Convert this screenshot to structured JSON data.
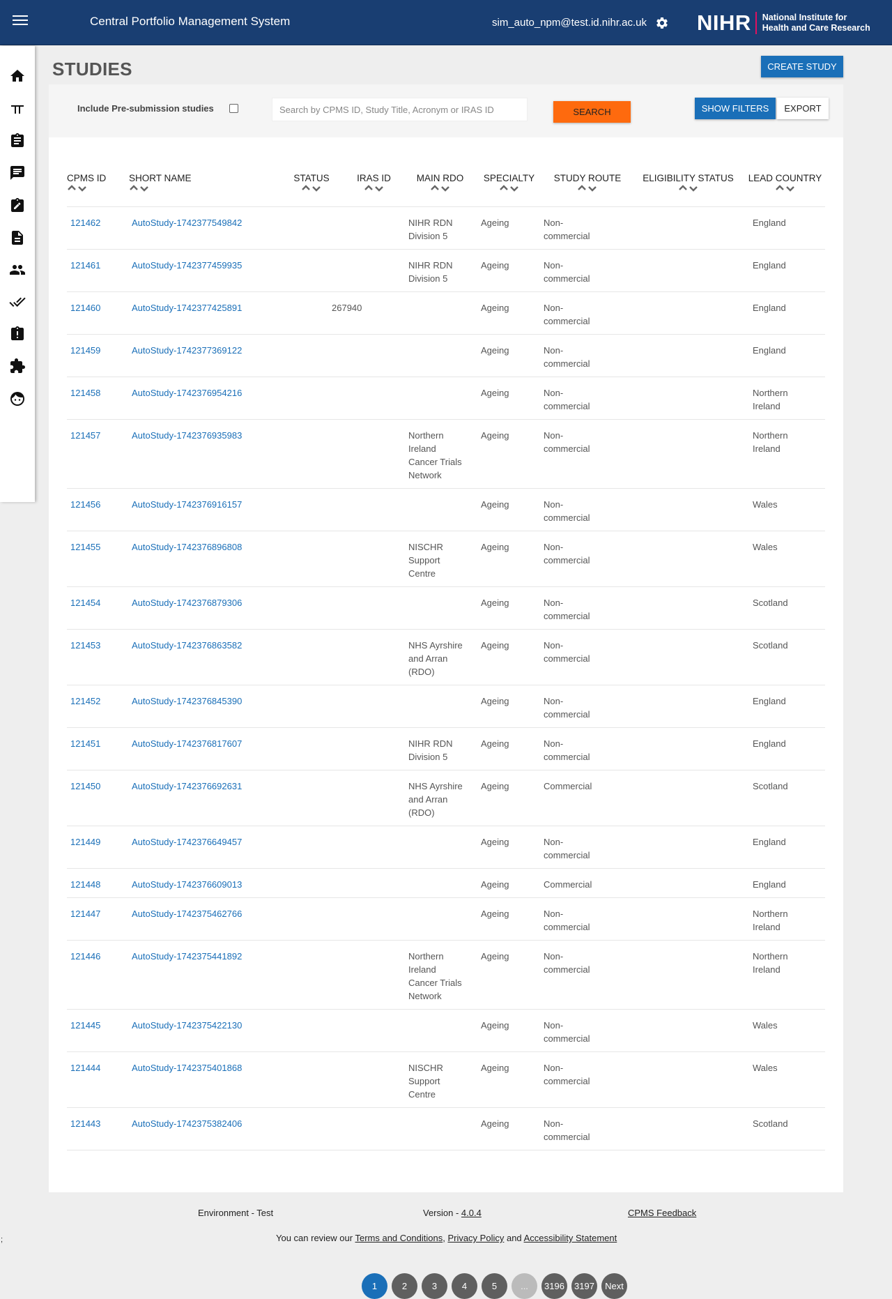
{
  "header": {
    "app_title": "Central Portfolio Management System",
    "user_email": "sim_auto_npm@test.id.nihr.ac.uk",
    "logo_word": "NIHR",
    "logo_sub_1": "National Institute for",
    "logo_sub_2": "Health and Care Research"
  },
  "sidebar": {
    "items": [
      {
        "icon": "home-icon"
      },
      {
        "icon": "table-icon"
      },
      {
        "icon": "clipboard-icon"
      },
      {
        "icon": "feedback-icon"
      },
      {
        "icon": "edit-clipboard-icon"
      },
      {
        "icon": "document-icon"
      },
      {
        "icon": "people-icon"
      },
      {
        "icon": "double-check-icon"
      },
      {
        "icon": "alert-clipboard-icon"
      },
      {
        "icon": "extension-icon"
      },
      {
        "icon": "face-icon"
      }
    ]
  },
  "page": {
    "title": "STUDIES",
    "create_button": "CREATE STUDY"
  },
  "filters": {
    "include_presubmission_label": "Include Pre-submission studies",
    "search_placeholder": "Search by CPMS ID, Study Title, Acronym or IRAS ID",
    "search_button": "SEARCH",
    "show_filters_button": "SHOW FILTERS",
    "export_button": "EXPORT"
  },
  "table": {
    "columns": [
      "CPMS ID",
      "SHORT NAME",
      "STATUS",
      "IRAS ID",
      "MAIN RDO",
      "SPECIALTY",
      "STUDY ROUTE",
      "ELIGIBILITY STATUS",
      "LEAD COUNTRY"
    ],
    "rows": [
      {
        "cpms_id": "121462",
        "short_name": "AutoStudy-1742377549842",
        "status": "",
        "iras_id": "",
        "main_rdo": "NIHR RDN Division 5",
        "specialty": "Ageing",
        "study_route": "Non-commercial",
        "eligibility": "",
        "lead_country": "England"
      },
      {
        "cpms_id": "121461",
        "short_name": "AutoStudy-1742377459935",
        "status": "",
        "iras_id": "",
        "main_rdo": "NIHR RDN Division 5",
        "specialty": "Ageing",
        "study_route": "Non-commercial",
        "eligibility": "",
        "lead_country": "England"
      },
      {
        "cpms_id": "121460",
        "short_name": "AutoStudy-1742377425891",
        "status": "",
        "iras_id": "267940",
        "main_rdo": "",
        "specialty": "Ageing",
        "study_route": "Non-commercial",
        "eligibility": "",
        "lead_country": "England"
      },
      {
        "cpms_id": "121459",
        "short_name": "AutoStudy-1742377369122",
        "status": "",
        "iras_id": "",
        "main_rdo": "",
        "specialty": "Ageing",
        "study_route": "Non-commercial",
        "eligibility": "",
        "lead_country": "England"
      },
      {
        "cpms_id": "121458",
        "short_name": "AutoStudy-1742376954216",
        "status": "",
        "iras_id": "",
        "main_rdo": "",
        "specialty": "Ageing",
        "study_route": "Non-commercial",
        "eligibility": "",
        "lead_country": "Northern Ireland"
      },
      {
        "cpms_id": "121457",
        "short_name": "AutoStudy-1742376935983",
        "status": "",
        "iras_id": "",
        "main_rdo": "Northern Ireland Cancer Trials Network",
        "specialty": "Ageing",
        "study_route": "Non-commercial",
        "eligibility": "",
        "lead_country": "Northern Ireland"
      },
      {
        "cpms_id": "121456",
        "short_name": "AutoStudy-1742376916157",
        "status": "",
        "iras_id": "",
        "main_rdo": "",
        "specialty": "Ageing",
        "study_route": "Non-commercial",
        "eligibility": "",
        "lead_country": "Wales"
      },
      {
        "cpms_id": "121455",
        "short_name": "AutoStudy-1742376896808",
        "status": "",
        "iras_id": "",
        "main_rdo": "NISCHR Support Centre",
        "specialty": "Ageing",
        "study_route": "Non-commercial",
        "eligibility": "",
        "lead_country": "Wales"
      },
      {
        "cpms_id": "121454",
        "short_name": "AutoStudy-1742376879306",
        "status": "",
        "iras_id": "",
        "main_rdo": "",
        "specialty": "Ageing",
        "study_route": "Non-commercial",
        "eligibility": "",
        "lead_country": "Scotland"
      },
      {
        "cpms_id": "121453",
        "short_name": "AutoStudy-1742376863582",
        "status": "",
        "iras_id": "",
        "main_rdo": "NHS Ayrshire and Arran (RDO)",
        "specialty": "Ageing",
        "study_route": "Non-commercial",
        "eligibility": "",
        "lead_country": "Scotland"
      },
      {
        "cpms_id": "121452",
        "short_name": "AutoStudy-1742376845390",
        "status": "",
        "iras_id": "",
        "main_rdo": "",
        "specialty": "Ageing",
        "study_route": "Non-commercial",
        "eligibility": "",
        "lead_country": "England"
      },
      {
        "cpms_id": "121451",
        "short_name": "AutoStudy-1742376817607",
        "status": "",
        "iras_id": "",
        "main_rdo": "NIHR RDN Division 5",
        "specialty": "Ageing",
        "study_route": "Non-commercial",
        "eligibility": "",
        "lead_country": "England"
      },
      {
        "cpms_id": "121450",
        "short_name": "AutoStudy-1742376692631",
        "status": "",
        "iras_id": "",
        "main_rdo": "NHS Ayrshire and Arran (RDO)",
        "specialty": "Ageing",
        "study_route": "Commercial",
        "eligibility": "",
        "lead_country": "Scotland"
      },
      {
        "cpms_id": "121449",
        "short_name": "AutoStudy-1742376649457",
        "status": "",
        "iras_id": "",
        "main_rdo": "",
        "specialty": "Ageing",
        "study_route": "Non-commercial",
        "eligibility": "",
        "lead_country": "England"
      },
      {
        "cpms_id": "121448",
        "short_name": "AutoStudy-1742376609013",
        "status": "",
        "iras_id": "",
        "main_rdo": "",
        "specialty": "Ageing",
        "study_route": "Commercial",
        "eligibility": "",
        "lead_country": "England"
      },
      {
        "cpms_id": "121447",
        "short_name": "AutoStudy-1742375462766",
        "status": "",
        "iras_id": "",
        "main_rdo": "",
        "specialty": "Ageing",
        "study_route": "Non-commercial",
        "eligibility": "",
        "lead_country": "Northern Ireland"
      },
      {
        "cpms_id": "121446",
        "short_name": "AutoStudy-1742375441892",
        "status": "",
        "iras_id": "",
        "main_rdo": "Northern Ireland Cancer Trials Network",
        "specialty": "Ageing",
        "study_route": "Non-commercial",
        "eligibility": "",
        "lead_country": "Northern Ireland"
      },
      {
        "cpms_id": "121445",
        "short_name": "AutoStudy-1742375422130",
        "status": "",
        "iras_id": "",
        "main_rdo": "",
        "specialty": "Ageing",
        "study_route": "Non-commercial",
        "eligibility": "",
        "lead_country": "Wales"
      },
      {
        "cpms_id": "121444",
        "short_name": "AutoStudy-1742375401868",
        "status": "",
        "iras_id": "",
        "main_rdo": "NISCHR Support Centre",
        "specialty": "Ageing",
        "study_route": "Non-commercial",
        "eligibility": "",
        "lead_country": "Wales"
      },
      {
        "cpms_id": "121443",
        "short_name": "AutoStudy-1742375382406",
        "status": "",
        "iras_id": "",
        "main_rdo": "",
        "specialty": "Ageing",
        "study_route": "Non-commercial",
        "eligibility": "",
        "lead_country": "Scotland"
      }
    ]
  },
  "pagination": {
    "pages": [
      "1",
      "2",
      "3",
      "4",
      "5",
      "...",
      "3196",
      "3197",
      "Next"
    ],
    "active": "1"
  },
  "footer": {
    "environment": "Environment - Test",
    "version_label": "Version - ",
    "version": "4.0.4",
    "feedback": "CPMS Feedback",
    "review_prefix": "You can review our ",
    "terms": "Terms and Conditions",
    "comma": ", ",
    "privacy": "Privacy Policy",
    "and": " and ",
    "accessibility": "Accessibility Statement",
    "edge_mark": ";"
  },
  "colors": {
    "header_bg": "#193e72",
    "primary": "#1a6fb8",
    "search_button": "#fe6a0e",
    "logo_accent": "#e0115f"
  }
}
